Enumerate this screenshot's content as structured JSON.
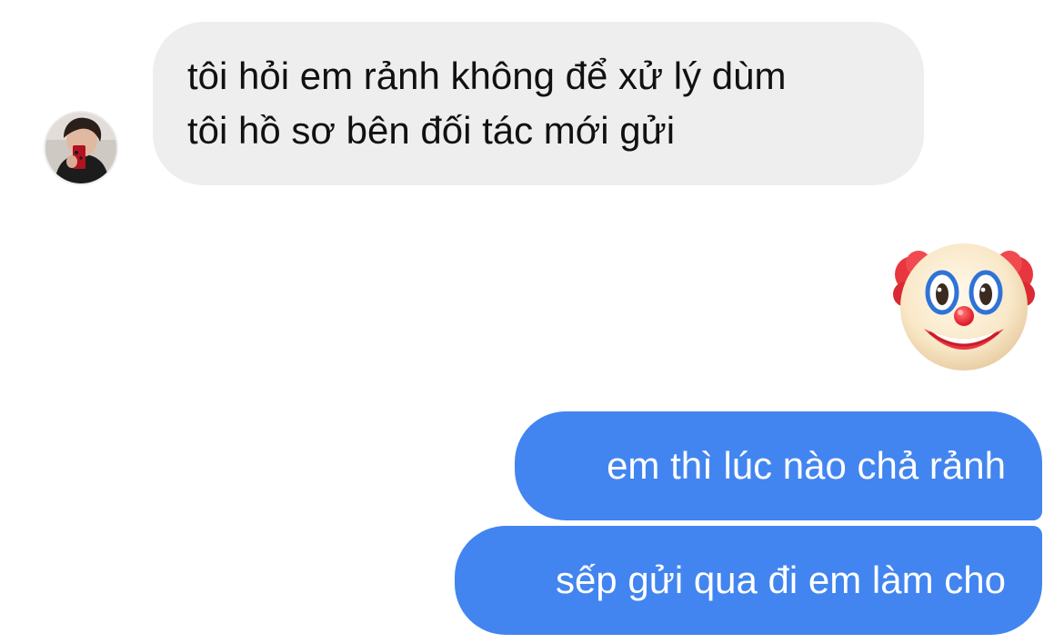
{
  "conversation": {
    "incoming": {
      "avatar_icon": "contact-photo-avatar",
      "lines": [
        "tôi hỏi em rảnh không để xử lý dùm",
        "tôi hồ sơ bên đối tác mới gửi"
      ]
    },
    "reaction": {
      "emoji_icon": "clown-face-emoji"
    },
    "outgoing": [
      {
        "text": "em thì lúc nào chả rảnh"
      },
      {
        "text": "sếp gửi qua đi em làm cho"
      }
    ]
  },
  "colors": {
    "background": "#ffffff",
    "incoming_bubble": "#eeeeee",
    "incoming_text": "#111111",
    "outgoing_bubble": "#4285f0",
    "outgoing_text": "#ffffff"
  }
}
